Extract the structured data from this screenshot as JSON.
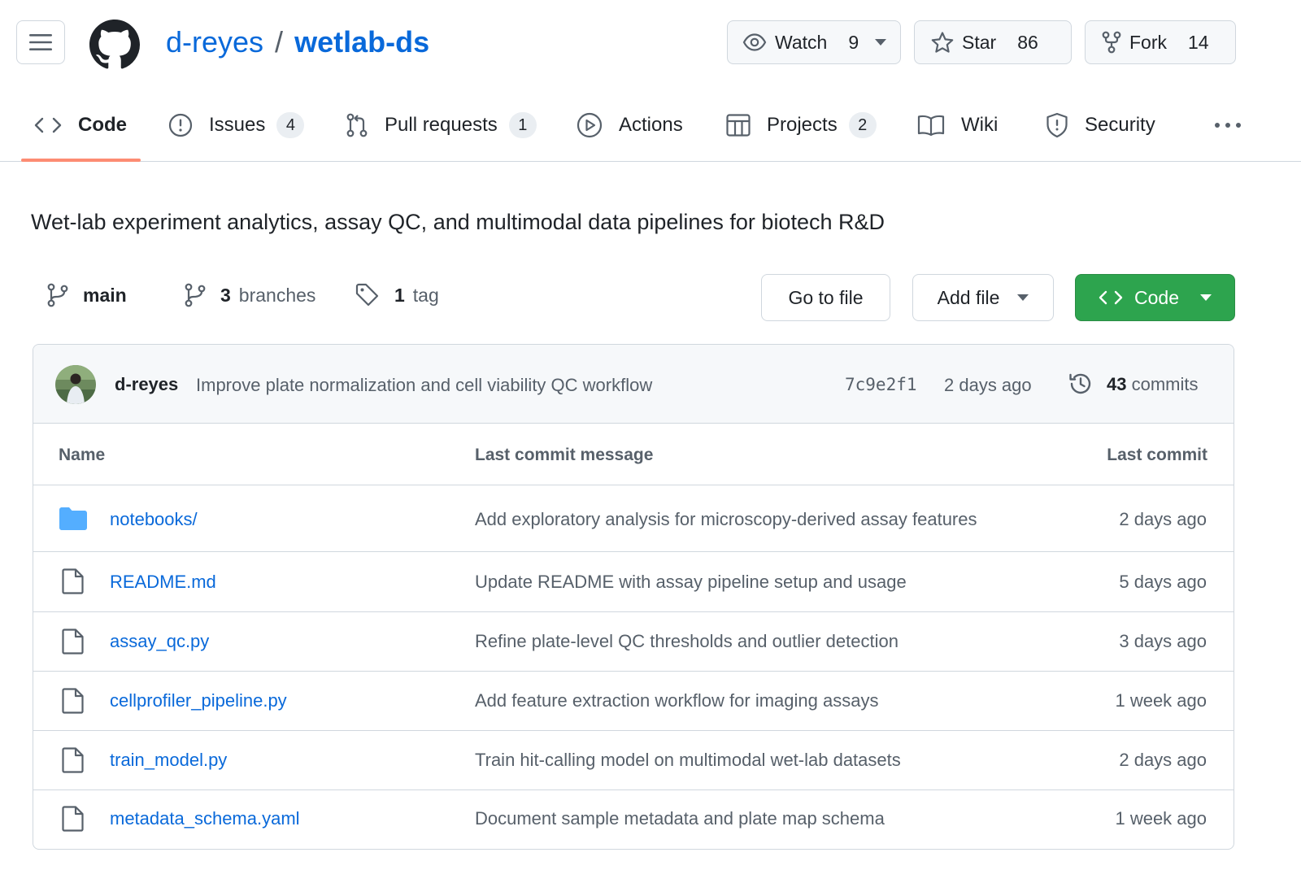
{
  "header": {
    "owner": "d-reyes",
    "separator": "/",
    "repo": "wetlab-ds",
    "watch": {
      "label": "Watch",
      "count": "9"
    },
    "star": {
      "label": "Star",
      "count": "86"
    },
    "fork": {
      "label": "Fork",
      "count": "14"
    }
  },
  "tabs": [
    {
      "label": "Code",
      "icon": "code-icon",
      "active": true
    },
    {
      "label": "Issues",
      "count": "4",
      "icon": "issue-icon"
    },
    {
      "label": "Pull requests",
      "count": "1",
      "icon": "pull-request-icon"
    },
    {
      "label": "Actions",
      "icon": "play-icon"
    },
    {
      "label": "Projects",
      "count": "2",
      "icon": "table-icon"
    },
    {
      "label": "Wiki",
      "icon": "book-icon"
    },
    {
      "label": "Security",
      "icon": "shield-icon"
    }
  ],
  "description": "Wet-lab experiment analytics, assay QC, and multimodal data pipelines for biotech R&D",
  "branchbar": {
    "branch": "main",
    "branches_count": "3",
    "branches_label": "branches",
    "tags_count": "1",
    "tags_label": "tag",
    "goto_file": "Go to file",
    "add_file": "Add file",
    "code": "Code"
  },
  "latest_commit": {
    "author": "d-reyes",
    "message": "Improve plate normalization and cell viability QC workflow",
    "sha": "7c9e2f1",
    "date": "2 days ago",
    "commits_count": "43",
    "commits_label": "commits"
  },
  "table": {
    "headers": {
      "name": "Name",
      "message": "Last commit message",
      "date": "Last commit"
    },
    "rows": [
      {
        "type": "folder",
        "name": "notebooks/",
        "message": "Add exploratory analysis for microscopy-derived assay features",
        "date": "2 days ago"
      },
      {
        "type": "file",
        "name": "README.md",
        "message": "Update README with assay pipeline setup and usage",
        "date": "5 days ago"
      },
      {
        "type": "file",
        "name": "assay_qc.py",
        "message": "Refine plate-level QC thresholds and outlier detection",
        "date": "3 days ago"
      },
      {
        "type": "file",
        "name": "cellprofiler_pipeline.py",
        "message": "Add feature extraction workflow for imaging assays",
        "date": "1 week ago"
      },
      {
        "type": "file",
        "name": "train_model.py",
        "message": "Train hit-calling model on multimodal wet-lab datasets",
        "date": "2 days ago"
      },
      {
        "type": "file",
        "name": "metadata_schema.yaml",
        "message": "Document sample metadata and plate map schema",
        "date": "1 week ago"
      }
    ]
  },
  "colors": {
    "link": "#0969da",
    "primary_button": "#2da44e",
    "active_tab_underline": "#fd8c73",
    "folder_icon": "#54aeff"
  }
}
